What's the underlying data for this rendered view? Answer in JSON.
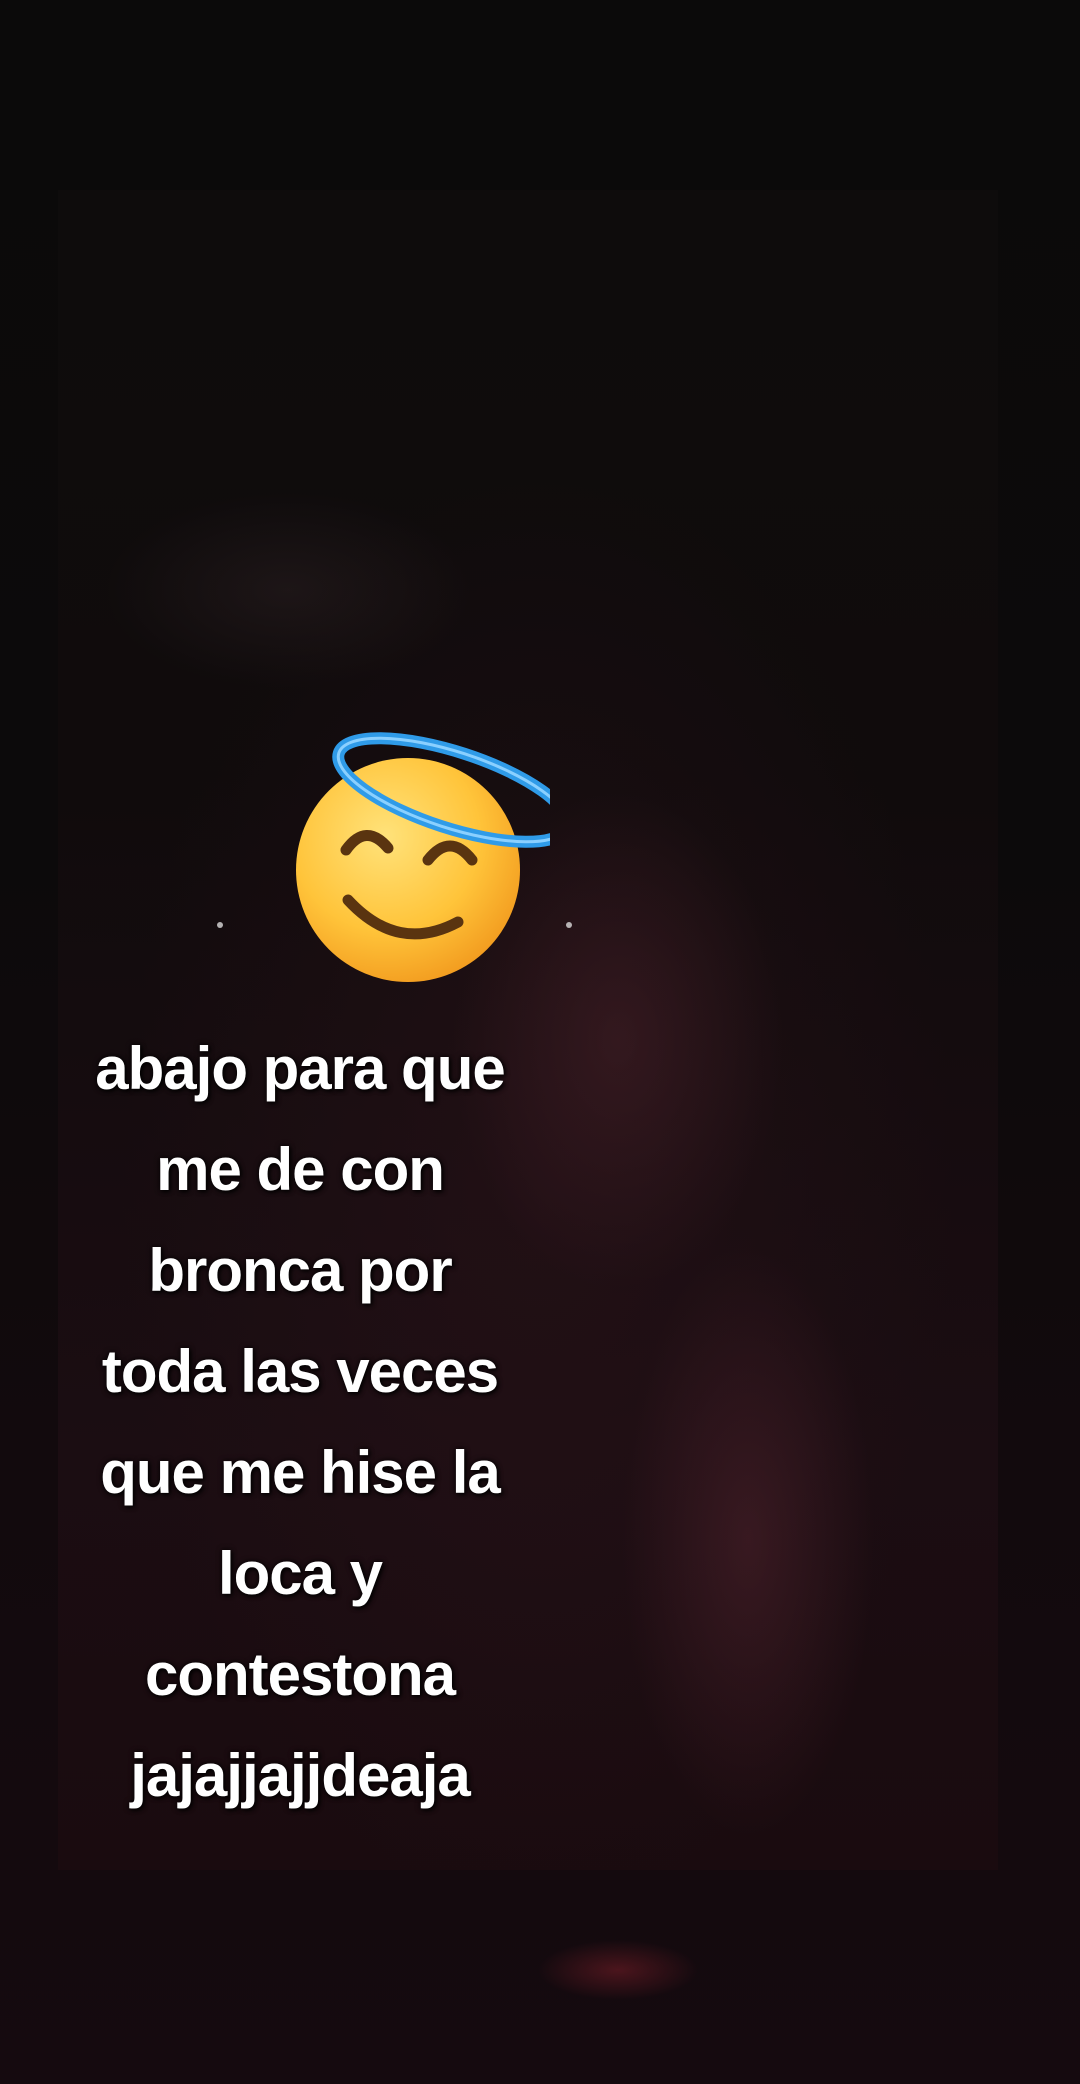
{
  "photo": {
    "stickers": [
      "smiling-face-with-halo-emoji"
    ]
  },
  "caption": {
    "lines": [
      "abajo para que",
      "me de con",
      "bronca por",
      "toda las veces",
      "que me hise la",
      "loca y",
      "contestona",
      "jajajjajjdeaja"
    ]
  },
  "colors": {
    "caption_text": "#ffffff",
    "halo": "#2f9be8",
    "emoji_face": "#ffc43a"
  }
}
